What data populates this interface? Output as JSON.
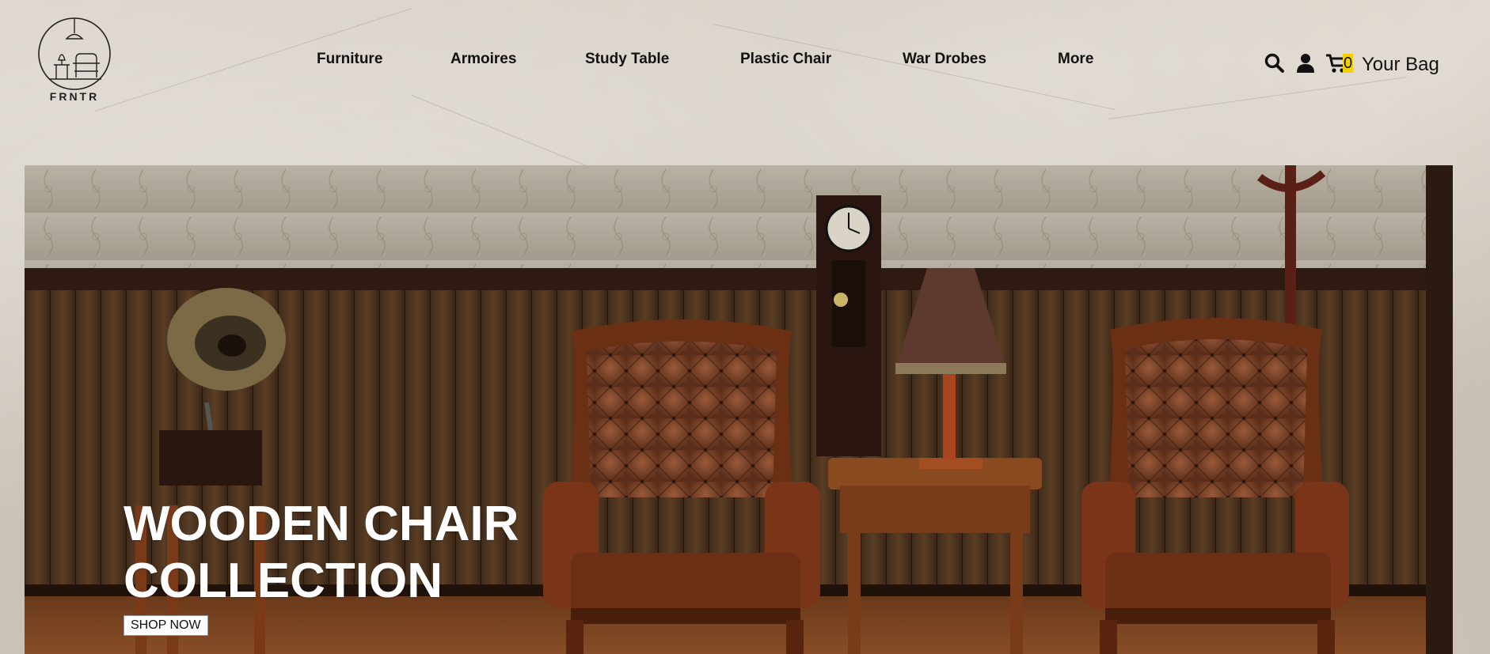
{
  "brand": {
    "name": "FRNTR"
  },
  "nav": {
    "items": [
      {
        "label": "Furniture"
      },
      {
        "label": "Armoires"
      },
      {
        "label": "Study Table"
      },
      {
        "label": "Plastic Chair"
      },
      {
        "label": "War Drobes"
      },
      {
        "label": "More"
      }
    ]
  },
  "actions": {
    "search_icon": "search-icon",
    "user_icon": "user-icon",
    "cart_icon": "cart-icon",
    "cart_count": "0",
    "bag_label": "Your Bag"
  },
  "hero": {
    "title_line1": "WOODEN CHAIR",
    "title_line2": "COLLECTION",
    "cta_label": "SHOP NOW"
  },
  "colors": {
    "accent_badge": "#f5d000",
    "text": "#111111",
    "hero_text": "#ffffff"
  }
}
